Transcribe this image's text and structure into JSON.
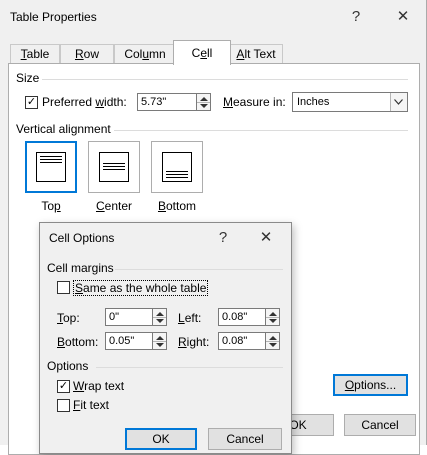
{
  "main": {
    "title": "Table Properties",
    "help": "?",
    "close": "✕",
    "tabs": [
      {
        "accel": "T",
        "rest": "able"
      },
      {
        "accel": "R",
        "rest": "ow"
      },
      {
        "pre": "Col",
        "accel": "u",
        "rest": "mn"
      },
      {
        "pre": "C",
        "accel": "e",
        "rest": "ll"
      },
      {
        "accel": "A",
        "rest": "lt Text"
      }
    ],
    "size": {
      "label": "Size",
      "preferred_width_pre": "Preferred ",
      "preferred_width_accel": "w",
      "preferred_width_rest": "idth:",
      "preferred_width_value": "5.73\"",
      "measure_pre": "",
      "measure_accel": "M",
      "measure_rest": "easure in:",
      "measure_value": "Inches"
    },
    "vertical_alignment": {
      "label": "Vertical alignment",
      "options": [
        {
          "pre": "To",
          "accel": "p",
          "rest": ""
        },
        {
          "pre": "",
          "accel": "C",
          "rest": "enter"
        },
        {
          "pre": "",
          "accel": "B",
          "rest": "ottom"
        }
      ]
    },
    "options_button": {
      "pre": "",
      "accel": "O",
      "rest": "ptions..."
    },
    "ok_label": "OK",
    "cancel_label": "Cancel"
  },
  "cell_options": {
    "title": "Cell Options",
    "help": "?",
    "close": "✕",
    "margins_label": "Cell margins",
    "same_as_whole_pre": "",
    "same_as_whole_accel": "S",
    "same_as_whole_rest": "ame as the whole table",
    "top": {
      "accel": "T",
      "rest": "op:",
      "value": "0\""
    },
    "left": {
      "accel": "L",
      "rest": "eft:",
      "value": "0.08\""
    },
    "bottom": {
      "accel": "B",
      "rest": "ottom:",
      "value": "0.05\""
    },
    "right": {
      "accel": "R",
      "rest": "ight:",
      "value": "0.08\""
    },
    "options_label": "Options",
    "wrap_text_accel": "W",
    "wrap_text_rest": "rap text",
    "fit_text_accel": "F",
    "fit_text_rest": "it text",
    "ok_label": "OK",
    "cancel_label": "Cancel",
    "checkmark": "✓"
  }
}
